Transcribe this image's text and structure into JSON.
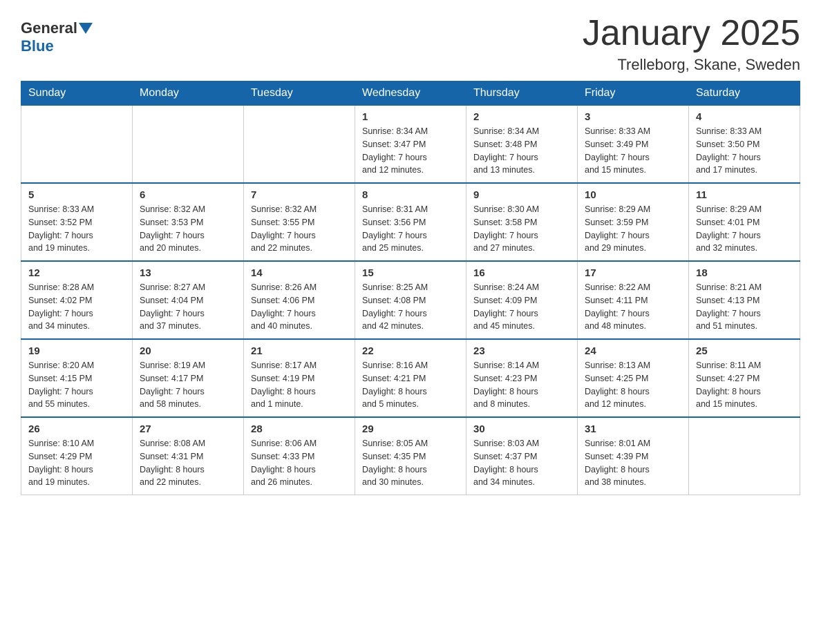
{
  "logo": {
    "general": "General",
    "blue": "Blue"
  },
  "title": "January 2025",
  "location": "Trelleborg, Skane, Sweden",
  "days_of_week": [
    "Sunday",
    "Monday",
    "Tuesday",
    "Wednesday",
    "Thursday",
    "Friday",
    "Saturday"
  ],
  "weeks": [
    [
      {
        "num": "",
        "info": ""
      },
      {
        "num": "",
        "info": ""
      },
      {
        "num": "",
        "info": ""
      },
      {
        "num": "1",
        "info": "Sunrise: 8:34 AM\nSunset: 3:47 PM\nDaylight: 7 hours\nand 12 minutes."
      },
      {
        "num": "2",
        "info": "Sunrise: 8:34 AM\nSunset: 3:48 PM\nDaylight: 7 hours\nand 13 minutes."
      },
      {
        "num": "3",
        "info": "Sunrise: 8:33 AM\nSunset: 3:49 PM\nDaylight: 7 hours\nand 15 minutes."
      },
      {
        "num": "4",
        "info": "Sunrise: 8:33 AM\nSunset: 3:50 PM\nDaylight: 7 hours\nand 17 minutes."
      }
    ],
    [
      {
        "num": "5",
        "info": "Sunrise: 8:33 AM\nSunset: 3:52 PM\nDaylight: 7 hours\nand 19 minutes."
      },
      {
        "num": "6",
        "info": "Sunrise: 8:32 AM\nSunset: 3:53 PM\nDaylight: 7 hours\nand 20 minutes."
      },
      {
        "num": "7",
        "info": "Sunrise: 8:32 AM\nSunset: 3:55 PM\nDaylight: 7 hours\nand 22 minutes."
      },
      {
        "num": "8",
        "info": "Sunrise: 8:31 AM\nSunset: 3:56 PM\nDaylight: 7 hours\nand 25 minutes."
      },
      {
        "num": "9",
        "info": "Sunrise: 8:30 AM\nSunset: 3:58 PM\nDaylight: 7 hours\nand 27 minutes."
      },
      {
        "num": "10",
        "info": "Sunrise: 8:29 AM\nSunset: 3:59 PM\nDaylight: 7 hours\nand 29 minutes."
      },
      {
        "num": "11",
        "info": "Sunrise: 8:29 AM\nSunset: 4:01 PM\nDaylight: 7 hours\nand 32 minutes."
      }
    ],
    [
      {
        "num": "12",
        "info": "Sunrise: 8:28 AM\nSunset: 4:02 PM\nDaylight: 7 hours\nand 34 minutes."
      },
      {
        "num": "13",
        "info": "Sunrise: 8:27 AM\nSunset: 4:04 PM\nDaylight: 7 hours\nand 37 minutes."
      },
      {
        "num": "14",
        "info": "Sunrise: 8:26 AM\nSunset: 4:06 PM\nDaylight: 7 hours\nand 40 minutes."
      },
      {
        "num": "15",
        "info": "Sunrise: 8:25 AM\nSunset: 4:08 PM\nDaylight: 7 hours\nand 42 minutes."
      },
      {
        "num": "16",
        "info": "Sunrise: 8:24 AM\nSunset: 4:09 PM\nDaylight: 7 hours\nand 45 minutes."
      },
      {
        "num": "17",
        "info": "Sunrise: 8:22 AM\nSunset: 4:11 PM\nDaylight: 7 hours\nand 48 minutes."
      },
      {
        "num": "18",
        "info": "Sunrise: 8:21 AM\nSunset: 4:13 PM\nDaylight: 7 hours\nand 51 minutes."
      }
    ],
    [
      {
        "num": "19",
        "info": "Sunrise: 8:20 AM\nSunset: 4:15 PM\nDaylight: 7 hours\nand 55 minutes."
      },
      {
        "num": "20",
        "info": "Sunrise: 8:19 AM\nSunset: 4:17 PM\nDaylight: 7 hours\nand 58 minutes."
      },
      {
        "num": "21",
        "info": "Sunrise: 8:17 AM\nSunset: 4:19 PM\nDaylight: 8 hours\nand 1 minute."
      },
      {
        "num": "22",
        "info": "Sunrise: 8:16 AM\nSunset: 4:21 PM\nDaylight: 8 hours\nand 5 minutes."
      },
      {
        "num": "23",
        "info": "Sunrise: 8:14 AM\nSunset: 4:23 PM\nDaylight: 8 hours\nand 8 minutes."
      },
      {
        "num": "24",
        "info": "Sunrise: 8:13 AM\nSunset: 4:25 PM\nDaylight: 8 hours\nand 12 minutes."
      },
      {
        "num": "25",
        "info": "Sunrise: 8:11 AM\nSunset: 4:27 PM\nDaylight: 8 hours\nand 15 minutes."
      }
    ],
    [
      {
        "num": "26",
        "info": "Sunrise: 8:10 AM\nSunset: 4:29 PM\nDaylight: 8 hours\nand 19 minutes."
      },
      {
        "num": "27",
        "info": "Sunrise: 8:08 AM\nSunset: 4:31 PM\nDaylight: 8 hours\nand 22 minutes."
      },
      {
        "num": "28",
        "info": "Sunrise: 8:06 AM\nSunset: 4:33 PM\nDaylight: 8 hours\nand 26 minutes."
      },
      {
        "num": "29",
        "info": "Sunrise: 8:05 AM\nSunset: 4:35 PM\nDaylight: 8 hours\nand 30 minutes."
      },
      {
        "num": "30",
        "info": "Sunrise: 8:03 AM\nSunset: 4:37 PM\nDaylight: 8 hours\nand 34 minutes."
      },
      {
        "num": "31",
        "info": "Sunrise: 8:01 AM\nSunset: 4:39 PM\nDaylight: 8 hours\nand 38 minutes."
      },
      {
        "num": "",
        "info": ""
      }
    ]
  ]
}
